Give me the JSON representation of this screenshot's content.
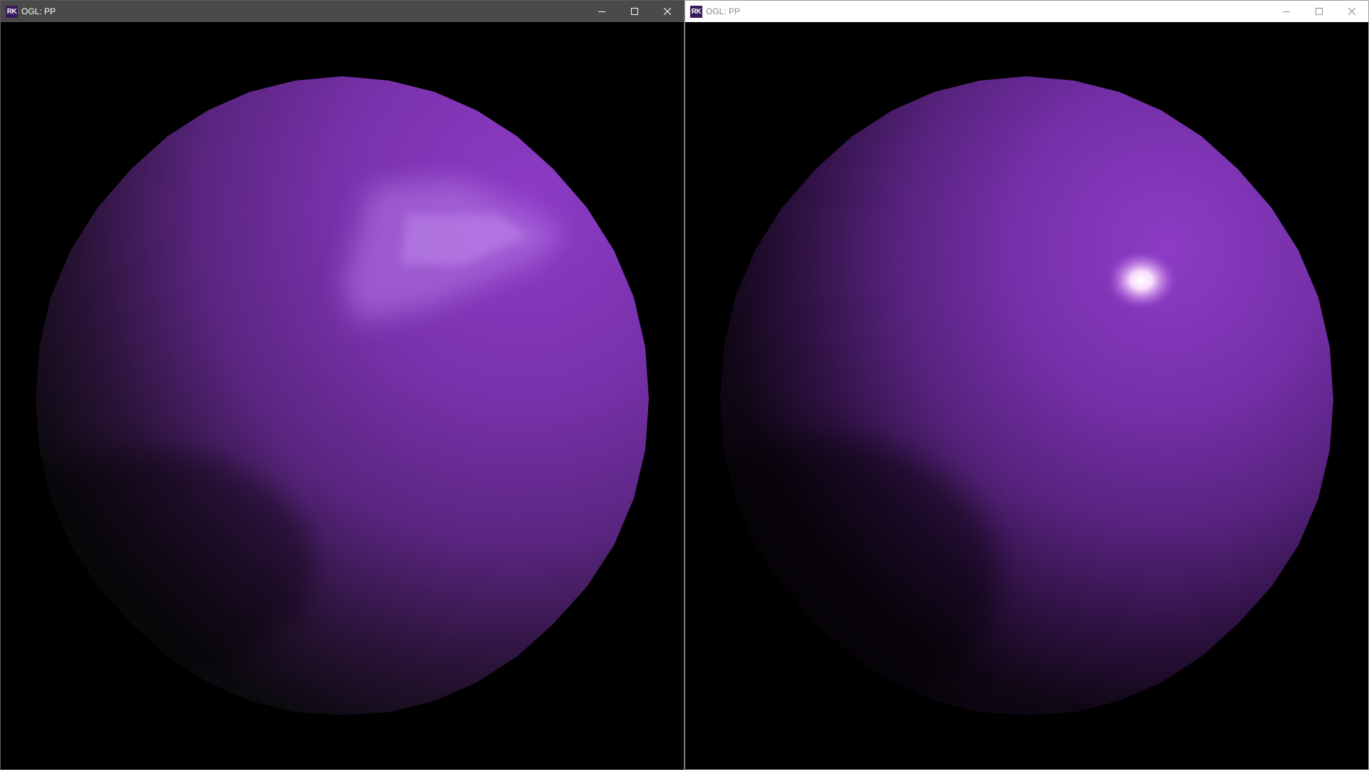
{
  "windows": [
    {
      "app_icon_text": "RK",
      "title": "OGL: PP",
      "state": "active",
      "caption_buttons": [
        "minimize-icon",
        "maximize-icon",
        "close-icon"
      ],
      "shading": "flat"
    },
    {
      "app_icon_text": "RK",
      "title": "OGL: PP",
      "state": "inactive",
      "caption_buttons": [
        "minimize-icon",
        "maximize-icon",
        "close-icon"
      ],
      "shading": "smooth"
    }
  ],
  "colors": {
    "sphere_base": "#7b2fae",
    "sphere_light": "#8e3bc4",
    "highlight": "#ffffff",
    "background": "#000000",
    "active_titlebar": "#4a4a4a",
    "inactive_titlebar": "#ffffff",
    "app_icon_bg": "#3a1a5c"
  }
}
